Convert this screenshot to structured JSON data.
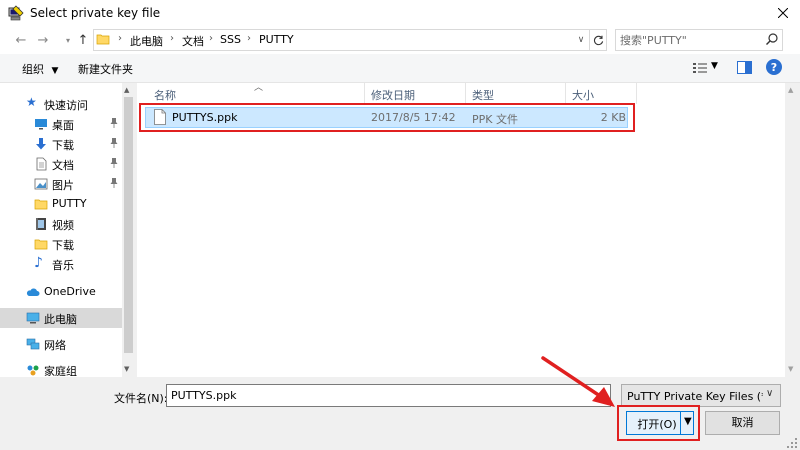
{
  "window": {
    "title": "Select private key file"
  },
  "address": {
    "crumbs": [
      "此电脑",
      "文档",
      "SSS",
      "PUTTY"
    ]
  },
  "search": {
    "placeholder": "搜索\"PUTTY\""
  },
  "toolbar": {
    "organize_label": "组织",
    "new_folder_label": "新建文件夹"
  },
  "nav": {
    "quick_access": "快速访问",
    "items": [
      {
        "label": "桌面",
        "icon": "desktop-icon",
        "pinned": true
      },
      {
        "label": "下载",
        "icon": "download-icon",
        "pinned": true
      },
      {
        "label": "文档",
        "icon": "document-icon",
        "pinned": true
      },
      {
        "label": "图片",
        "icon": "picture-icon",
        "pinned": true
      },
      {
        "label": "PUTTY",
        "icon": "folder-icon",
        "pinned": false
      },
      {
        "label": "视频",
        "icon": "video-icon",
        "pinned": false
      },
      {
        "label": "下载",
        "icon": "folder-icon",
        "pinned": false
      },
      {
        "label": "音乐",
        "icon": "music-icon",
        "pinned": false
      }
    ],
    "onedrive": "OneDrive",
    "this_pc": "此电脑",
    "network": "网络",
    "homegroup": "家庭组"
  },
  "columns": {
    "name": "名称",
    "modified": "修改日期",
    "type": "类型",
    "size": "大小"
  },
  "files": [
    {
      "name": "PUTTYS.ppk",
      "modified": "2017/8/5 17:42",
      "type": "PPK 文件",
      "size": "2 KB"
    }
  ],
  "bottom": {
    "filename_label": "文件名(N):",
    "filename_value": "PUTTYS.ppk",
    "filetype_value": "PuTTY Private Key Files (*.pp",
    "open_label": "打开(O)",
    "cancel_label": "取消"
  },
  "colors": {
    "selection_bg": "#cce8ff",
    "highlight_red": "#e02020",
    "accent": "#0078d7"
  }
}
